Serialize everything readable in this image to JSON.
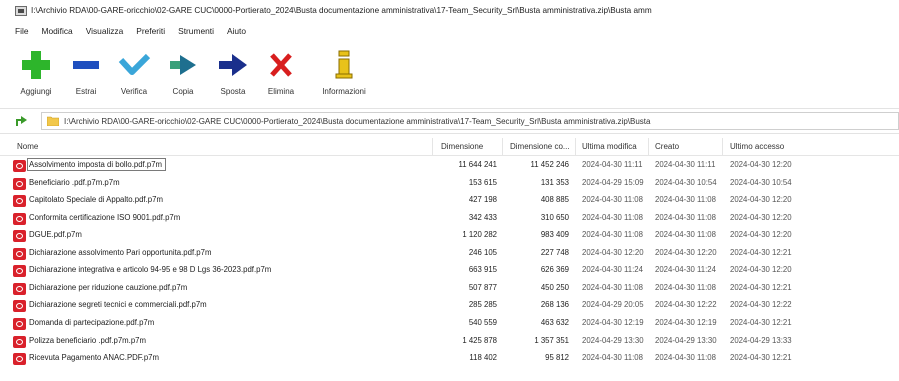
{
  "window": {
    "title": "I:\\Archivio RDA\\00-GARE-oricchio\\02-GARE CUC\\0000-Portierato_2024\\Busta documentazione amministrativa\\17-Team_Security_Srl\\Busta amministrativa.zip\\Busta amm"
  },
  "menu": [
    "File",
    "Modifica",
    "Visualizza",
    "Preferiti",
    "Strumenti",
    "Aiuto"
  ],
  "toolbar": {
    "add": "Aggiungi",
    "extract": "Estrai",
    "test": "Verifica",
    "copy": "Copia",
    "move": "Sposta",
    "delete": "Elimina",
    "info": "Informazioni"
  },
  "colors": {
    "add": "#2db52b",
    "extract": "#1f4fbf",
    "test": "#3aa6d9",
    "copy": "#3aa07a",
    "move": "#1a2f8c",
    "delete": "#d81e1e",
    "info": "#e8c21a",
    "file_icon": "#d9212b"
  },
  "address": {
    "path": "I:\\Archivio RDA\\00-GARE-oricchio\\02-GARE CUC\\0000-Portierato_2024\\Busta documentazione amministrativa\\17-Team_Security_Srl\\Busta amministrativa.zip\\Busta"
  },
  "columns": {
    "name": "Nome",
    "size": "Dimensione",
    "packed": "Dimensione co...",
    "modified": "Ultima modifica",
    "created": "Creato",
    "accessed": "Ultimo accesso"
  },
  "files": [
    {
      "name": "Assolvimento imposta di bollo.pdf.p7m",
      "size": "11 644 241",
      "packed": "11 452 246",
      "modified": "2024-04-30 11:11",
      "created": "2024-04-30 11:11",
      "accessed": "2024-04-30 12:20"
    },
    {
      "name": "Beneficiario .pdf.p7m.p7m",
      "size": "153 615",
      "packed": "131 353",
      "modified": "2024-04-29 15:09",
      "created": "2024-04-30 10:54",
      "accessed": "2024-04-30 10:54"
    },
    {
      "name": "Capitolato Speciale di Appalto.pdf.p7m",
      "size": "427 198",
      "packed": "408 885",
      "modified": "2024-04-30 11:08",
      "created": "2024-04-30 11:08",
      "accessed": "2024-04-30 12:20"
    },
    {
      "name": "Conformita certificazione ISO 9001.pdf.p7m",
      "size": "342 433",
      "packed": "310 650",
      "modified": "2024-04-30 11:08",
      "created": "2024-04-30 11:08",
      "accessed": "2024-04-30 12:20"
    },
    {
      "name": "DGUE.pdf.p7m",
      "size": "1 120 282",
      "packed": "983 409",
      "modified": "2024-04-30 11:08",
      "created": "2024-04-30 11:08",
      "accessed": "2024-04-30 12:20"
    },
    {
      "name": "Dichiarazione assolvimento Pari opportunita.pdf.p7m",
      "size": "246 105",
      "packed": "227 748",
      "modified": "2024-04-30 12:20",
      "created": "2024-04-30 12:20",
      "accessed": "2024-04-30 12:21"
    },
    {
      "name": "Dichiarazione integrativa e articolo 94-95 e 98 D Lgs 36-2023.pdf.p7m",
      "size": "663 915",
      "packed": "626 369",
      "modified": "2024-04-30 11:24",
      "created": "2024-04-30 11:24",
      "accessed": "2024-04-30 12:20"
    },
    {
      "name": "Dichiarazione per riduzione cauzione.pdf.p7m",
      "size": "507 877",
      "packed": "450 250",
      "modified": "2024-04-30 11:08",
      "created": "2024-04-30 11:08",
      "accessed": "2024-04-30 12:21"
    },
    {
      "name": "Dichiarazione segreti tecnici e commerciali.pdf.p7m",
      "size": "285 285",
      "packed": "268 136",
      "modified": "2024-04-29 20:05",
      "created": "2024-04-30 12:22",
      "accessed": "2024-04-30 12:22"
    },
    {
      "name": "Domanda di partecipazione.pdf.p7m",
      "size": "540 559",
      "packed": "463 632",
      "modified": "2024-04-30 12:19",
      "created": "2024-04-30 12:19",
      "accessed": "2024-04-30 12:21"
    },
    {
      "name": "Polizza beneficiario .pdf.p7m.p7m",
      "size": "1 425 878",
      "packed": "1 357 351",
      "modified": "2024-04-29 13:30",
      "created": "2024-04-29 13:30",
      "accessed": "2024-04-29 13:33"
    },
    {
      "name": "Ricevuta Pagamento ANAC.PDF.p7m",
      "size": "118 402",
      "packed": "95 812",
      "modified": "2024-04-30 11:08",
      "created": "2024-04-30 11:08",
      "accessed": "2024-04-30 12:21"
    }
  ]
}
